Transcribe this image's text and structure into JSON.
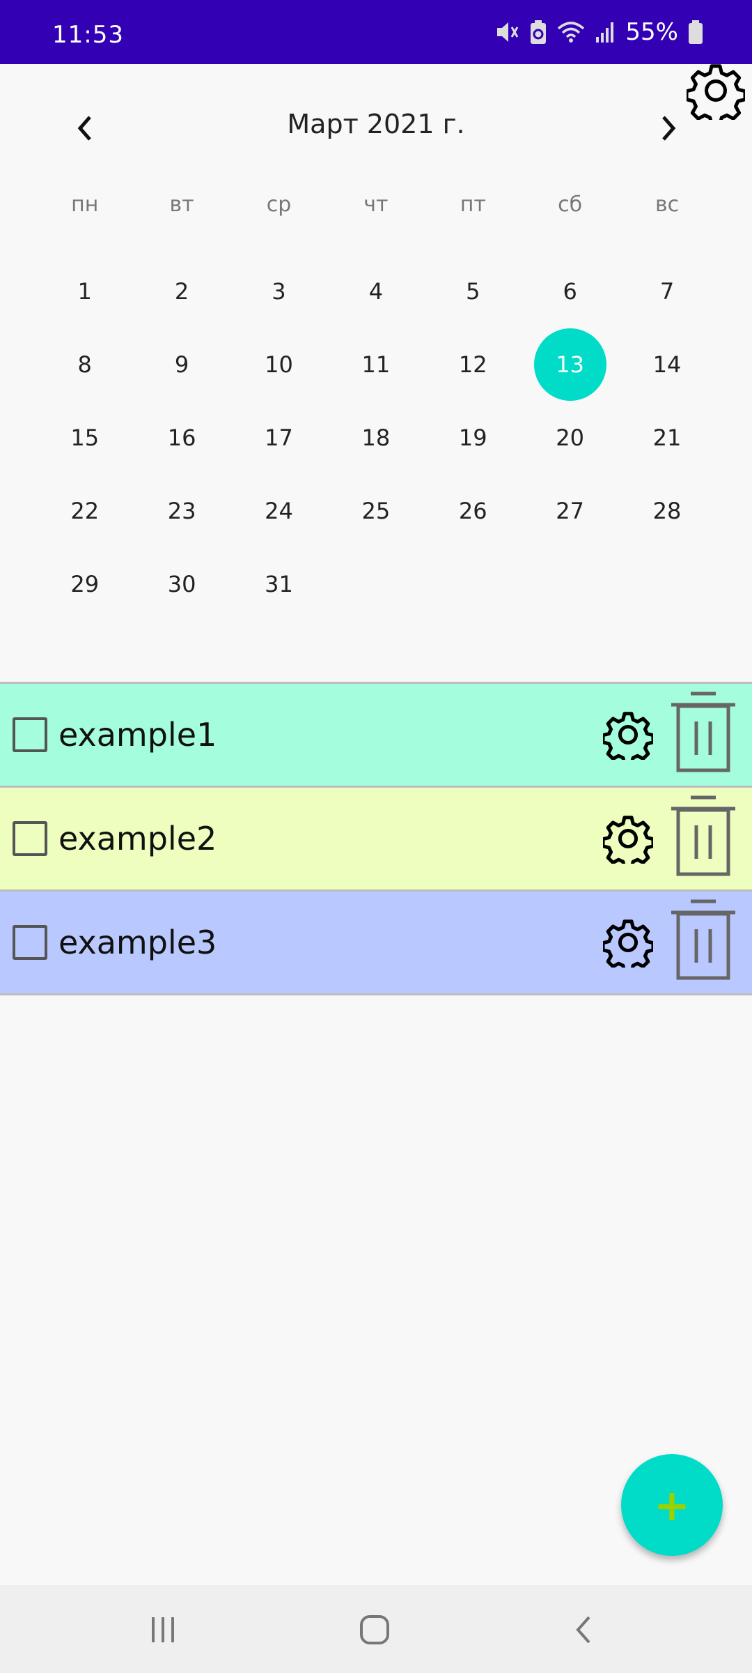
{
  "status_bar": {
    "time": "11:53",
    "battery_pct": "55%"
  },
  "calendar": {
    "title": "Март 2021 г.",
    "weekdays": [
      "пн",
      "вт",
      "ср",
      "чт",
      "пт",
      "сб",
      "вс"
    ],
    "days": [
      "1",
      "2",
      "3",
      "4",
      "5",
      "6",
      "7",
      "8",
      "9",
      "10",
      "11",
      "12",
      "13",
      "14",
      "15",
      "16",
      "17",
      "18",
      "19",
      "20",
      "21",
      "22",
      "23",
      "24",
      "25",
      "26",
      "27",
      "28",
      "29",
      "30",
      "31"
    ],
    "selected_day": "13",
    "selected_color": "#00dcc8"
  },
  "tasks": [
    {
      "label": "example1",
      "color": "#a4fddc",
      "checked": false
    },
    {
      "label": "example2",
      "color": "#edfebe",
      "checked": false
    },
    {
      "label": "example3",
      "color": "#b9c8fe",
      "checked": false
    }
  ],
  "fab": {
    "label": "+"
  },
  "icons": {
    "settings": "gear-icon",
    "prev_month": "chevron-left-icon",
    "next_month": "chevron-right-icon",
    "delete": "trash-icon",
    "add": "plus-icon"
  },
  "accent_color": "#00dcc8",
  "status_bar_color": "#3300b4"
}
